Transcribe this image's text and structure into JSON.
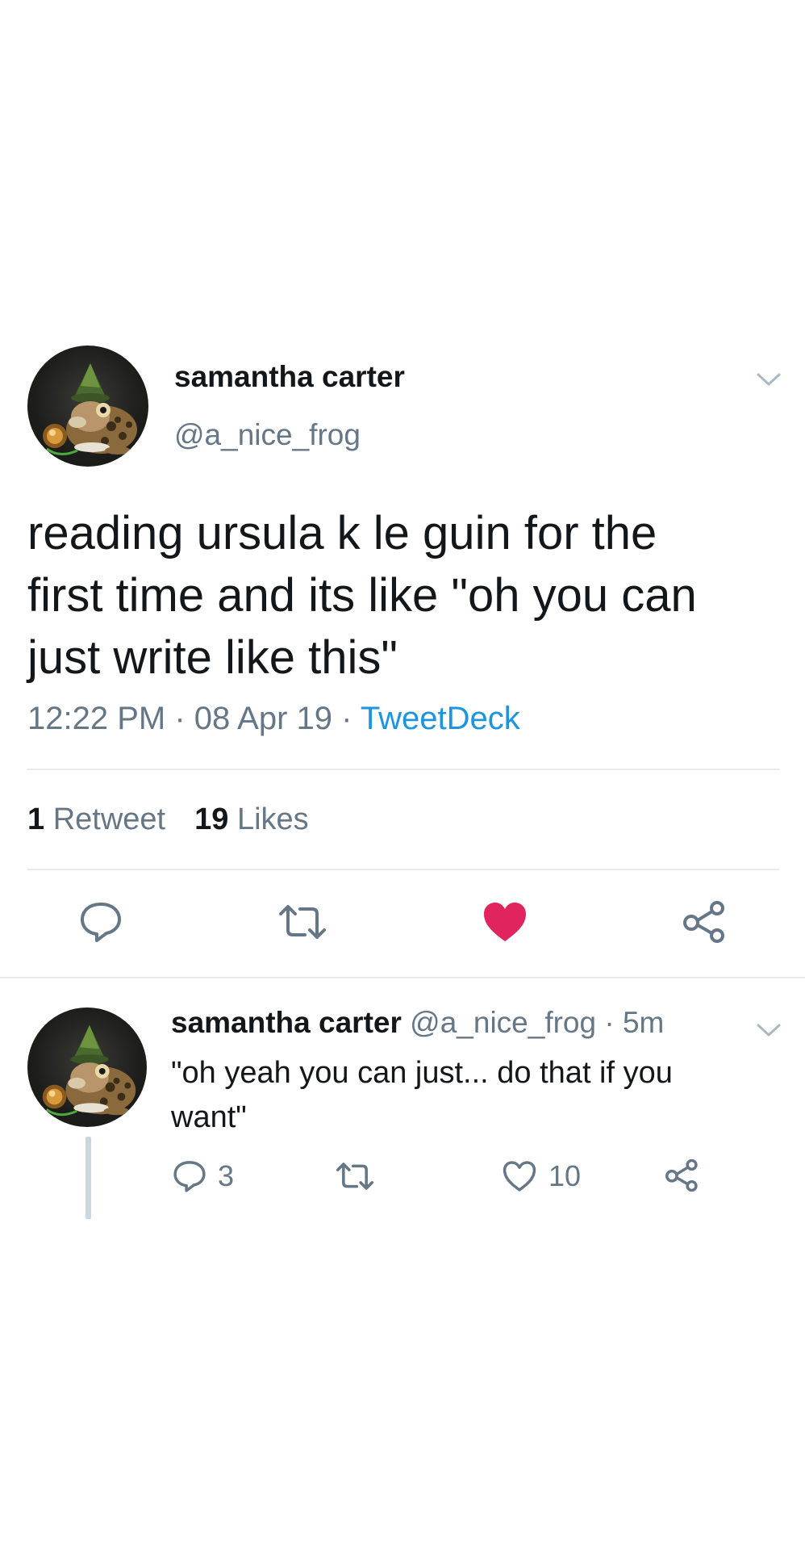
{
  "main_tweet": {
    "author": {
      "display_name": "samantha carter",
      "handle": "@a_nice_frog"
    },
    "text": "reading ursula k le guin for the\nfirst time and its like \"oh you can\njust write like this\"",
    "time": "12:22 PM",
    "date": "08 Apr 19",
    "source": "TweetDeck",
    "separator": " · ",
    "stats": {
      "retweet_count": "1",
      "retweet_label": "Retweet",
      "like_count": "19",
      "like_label": "Likes"
    },
    "liked": true,
    "icons": [
      "reply-icon",
      "retweet-icon",
      "heart-filled-icon",
      "share-icon",
      "chevron-down-icon"
    ]
  },
  "reply_tweet": {
    "author": {
      "display_name": "samantha carter",
      "handle": "@a_nice_frog"
    },
    "age": "5m",
    "separator": " · ",
    "text": "\"oh yeah you can just... do that if you\nwant\"",
    "reply_count": "3",
    "like_count": "10",
    "icons": [
      "reply-icon",
      "retweet-icon",
      "heart-outline-icon",
      "share-icon",
      "chevron-down-icon"
    ]
  },
  "colors": {
    "text": "#14171a",
    "secondary": "#657786",
    "link": "#1b95e0",
    "like": "#e0245e",
    "divider": "#e6ecf0",
    "thread_line": "#ccd6dd"
  }
}
